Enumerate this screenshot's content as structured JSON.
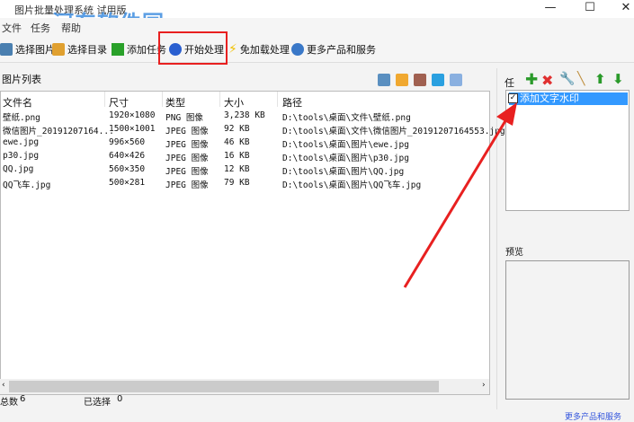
{
  "window": {
    "title": "图片批量处理系统 试用版",
    "min": "—",
    "max": "☐",
    "close": "✕"
  },
  "watermark": "河东软件园",
  "menu": [
    "文件",
    "任务",
    "帮助"
  ],
  "toolbar": [
    {
      "label": "选择图片",
      "icon": "image-icon",
      "color": "#4a7fb0"
    },
    {
      "label": "选择目录",
      "icon": "folder-icon",
      "color": "#e0a030"
    },
    {
      "label": "添加任务",
      "icon": "plus-icon",
      "color": "#2aa12a"
    },
    {
      "label": "开始处理",
      "icon": "play-icon",
      "color": "#2a5fd0"
    },
    {
      "label": "免加载处理",
      "icon": "lightning-icon",
      "color": "#f0c000"
    },
    {
      "label": "更多产品和服务",
      "icon": "globe-icon",
      "color": "#3a78c8"
    }
  ],
  "list": {
    "title": "图片列表",
    "columns": [
      "文件名",
      "尺寸",
      "类型",
      "大小",
      "路径"
    ],
    "rows": [
      [
        "壁纸.png",
        "1920×1080",
        "PNG 图像",
        "3,238 KB",
        "D:\\tools\\桌面\\文件\\壁纸.png"
      ],
      [
        "微信图片_20191207164...",
        "1500×1001",
        "JPEG 图像",
        "92 KB",
        "D:\\tools\\桌面\\文件\\微信图片_20191207164553.jpg"
      ],
      [
        "ewe.jpg",
        "996×560",
        "JPEG 图像",
        "46 KB",
        "D:\\tools\\桌面\\图片\\ewe.jpg"
      ],
      [
        "p30.jpg",
        "640×426",
        "JPEG 图像",
        "16 KB",
        "D:\\tools\\桌面\\图片\\p30.jpg"
      ],
      [
        "QQ.jpg",
        "560×350",
        "JPEG 图像",
        "12 KB",
        "D:\\tools\\桌面\\图片\\QQ.jpg"
      ],
      [
        "QQ飞车.jpg",
        "500×281",
        "JPEG 图像",
        "79 KB",
        "D:\\tools\\桌面\\图片\\QQ飞车.jpg"
      ]
    ]
  },
  "status": {
    "total_label": "总数",
    "total": "6",
    "selected_label": "已选择",
    "selected": "0"
  },
  "tasks": {
    "label": "任",
    "items": [
      {
        "label": "添加文字水印",
        "checked": true
      }
    ]
  },
  "preview": {
    "label": "预览"
  },
  "footer_link": "更多产品和服务"
}
